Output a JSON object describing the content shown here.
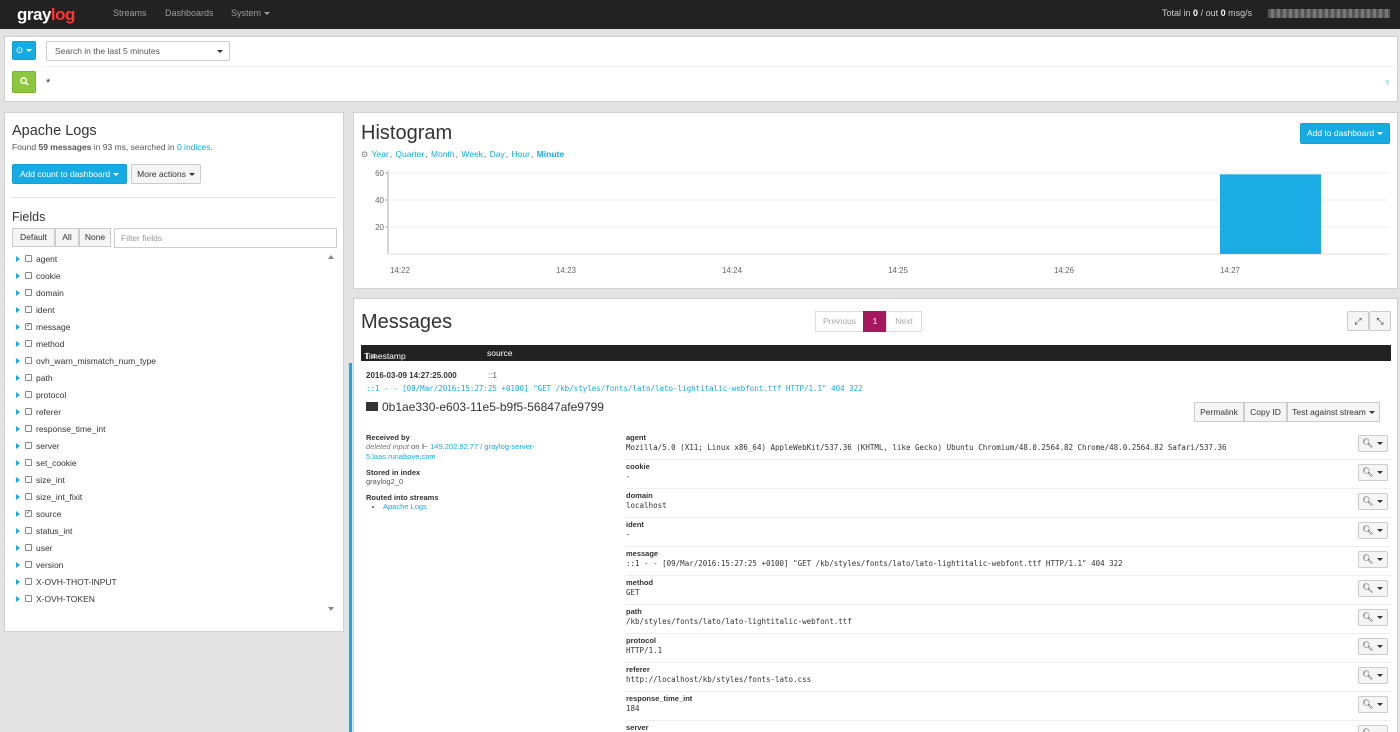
{
  "nav": {
    "logo_main": "gray",
    "logo_accent": "log",
    "items": [
      "Streams",
      "Dashboards",
      "System"
    ],
    "throughput": {
      "label": "Total in",
      "in": "0",
      "sep": "/ out",
      "out": "0",
      "unit": "msg/s"
    }
  },
  "search": {
    "range": "Search in the last 5 minutes",
    "query": "*"
  },
  "sidebar": {
    "title": "Apache Logs",
    "found_prefix": "Found",
    "found_count": "59 messages",
    "found_mid": "in 93 ms, searched in",
    "found_indices": "0 indices",
    "found_suffix": ".",
    "add_count": "Add count to dashboard",
    "more_actions": "More actions",
    "fields_title": "Fields",
    "filter_buttons": [
      "Default",
      "All",
      "None"
    ],
    "filter_placeholder": "Filter fields",
    "fields": [
      {
        "name": "agent",
        "checked": false
      },
      {
        "name": "cookie",
        "checked": false
      },
      {
        "name": "domain",
        "checked": false
      },
      {
        "name": "ident",
        "checked": false
      },
      {
        "name": "message",
        "checked": true
      },
      {
        "name": "method",
        "checked": false
      },
      {
        "name": "ovh_warn_mismatch_num_type",
        "checked": false
      },
      {
        "name": "path",
        "checked": false
      },
      {
        "name": "protocol",
        "checked": false
      },
      {
        "name": "referer",
        "checked": false
      },
      {
        "name": "response_time_int",
        "checked": false
      },
      {
        "name": "server",
        "checked": false
      },
      {
        "name": "set_cookie",
        "checked": false
      },
      {
        "name": "size_int",
        "checked": false
      },
      {
        "name": "size_int_fixit",
        "checked": false
      },
      {
        "name": "source",
        "checked": true
      },
      {
        "name": "status_int",
        "checked": false
      },
      {
        "name": "user",
        "checked": false
      },
      {
        "name": "version",
        "checked": false
      },
      {
        "name": "X-OVH-THOT-INPUT",
        "checked": false
      },
      {
        "name": "X-OVH-TOKEN",
        "checked": false
      }
    ]
  },
  "histogram": {
    "title": "Histogram",
    "resolutions": [
      "Year",
      "Quarter",
      "Month",
      "Week",
      "Day",
      "Hour"
    ],
    "active_resolution": "Minute",
    "add_to_dashboard": "Add to dashboard"
  },
  "chart_data": {
    "type": "bar",
    "categories": [
      "14:22",
      "14:23",
      "14:24",
      "14:25",
      "14:26",
      "14:27"
    ],
    "values": [
      0,
      0,
      0,
      0,
      0,
      59
    ],
    "yticks": [
      20,
      40,
      60
    ],
    "ylim": [
      0,
      60
    ],
    "bar_color": "#1aace3"
  },
  "messages": {
    "title": "Messages",
    "pager": {
      "prev": "Previous",
      "current": "1",
      "next": "Next"
    },
    "columns": [
      "Timestamp",
      "source"
    ],
    "timestamp": "2016-03-09 14:27:25.000",
    "source": "::1",
    "line": "::1 - - [09/Mar/2016:15:27:25 +0100] \"GET /kb/styles/fonts/lato/lato-lightitalic-webfont.ttf HTTP/1.1\" 404 322",
    "id": "0b1ae330-e603-11e5-b9f5-56847afe9799",
    "actions": [
      "Permalink",
      "Copy ID",
      "Test against stream"
    ],
    "received_label": "Received by",
    "received_input": "deleted input",
    "received_on": "on",
    "received_node": "149.202.92.77 / graylog-server-5.laas.runabove.com",
    "stored_label": "Stored in index",
    "stored_value": "graylog2_0",
    "routed_label": "Routed into streams",
    "routed_stream": "Apache Logs",
    "fields": [
      {
        "name": "agent",
        "value": "Mozilla/5.0 (X11; Linux x86_64) AppleWebKit/537.36 (KHTML, like Gecko) Ubuntu Chromium/48.0.2564.82 Chrome/48.0.2564.82 Safari/537.36"
      },
      {
        "name": "cookie",
        "value": "-"
      },
      {
        "name": "domain",
        "value": "localhost"
      },
      {
        "name": "ident",
        "value": "-"
      },
      {
        "name": "message",
        "value": "::1 - - [09/Mar/2016:15:27:25 +0100] \"GET /kb/styles/fonts/lato/lato-lightitalic-webfont.ttf HTTP/1.1\" 404 322"
      },
      {
        "name": "method",
        "value": "GET"
      },
      {
        "name": "path",
        "value": "/kb/styles/fonts/lato/lato-lightitalic-webfont.ttf"
      },
      {
        "name": "protocol",
        "value": "HTTP/1.1"
      },
      {
        "name": "referer",
        "value": "http://localhost/kb/styles/fonts-lato.css"
      },
      {
        "name": "response_time_int",
        "value": "184"
      },
      {
        "name": "server",
        "value": ""
      }
    ]
  },
  "colors": {
    "accent": "#16ace3",
    "success": "#8dc63f",
    "active_page": "#a6185e",
    "navbar": "#222222"
  }
}
